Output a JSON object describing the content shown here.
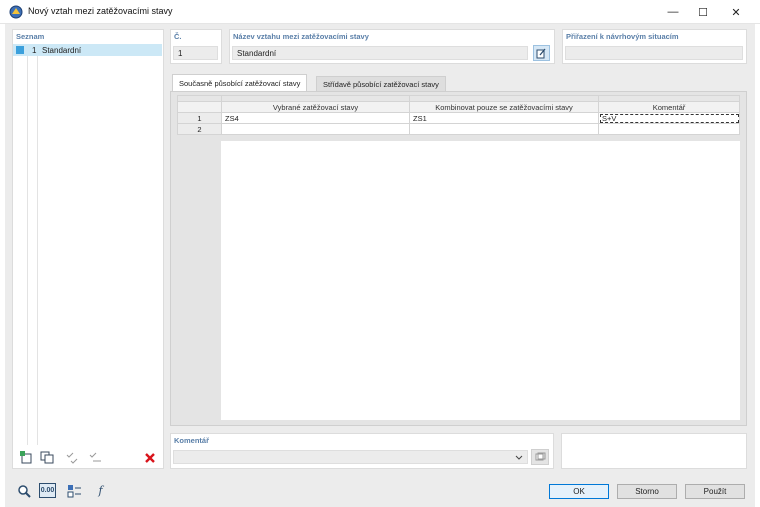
{
  "window": {
    "title": "Nový vztah mezi zatěžovacími stavy",
    "minimize": "—",
    "maximize": "☐",
    "close": "✕"
  },
  "list": {
    "header": "Seznam",
    "items": [
      {
        "number": "1",
        "label": "Standardní",
        "selected": true
      }
    ]
  },
  "number_field": {
    "label": "Č.",
    "value": "1"
  },
  "name_field": {
    "label": "Název vztahu mezi zatěžovacími stavy",
    "value": "Standardní"
  },
  "assign_field": {
    "label": "Přiřazení k návrhovým situacím",
    "value": ""
  },
  "tabs": [
    {
      "label": "Současně působící zatěžovací stavy",
      "active": true
    },
    {
      "label": "Střídavě působící zatěžovací stavy",
      "active": false
    }
  ],
  "table": {
    "columns": [
      "Vybrané zatěžovací stavy",
      "Kombinovat pouze se zatěžovacími stavy",
      "Komentář"
    ],
    "rows": [
      {
        "num": "1",
        "selected_cases": "ZS4",
        "combine_with": "ZS1",
        "comment": "S+V"
      },
      {
        "num": "2",
        "selected_cases": "",
        "combine_with": "",
        "comment": ""
      }
    ]
  },
  "comment_field": {
    "label": "Komentář",
    "value": ""
  },
  "buttons": {
    "ok": "OK",
    "cancel": "Storno",
    "apply": "Použít"
  },
  "colors": {
    "accent": "#5a7fa8",
    "selection": "#cce8f6",
    "ok_border": "#0078d7",
    "delete": "#d9141b"
  }
}
